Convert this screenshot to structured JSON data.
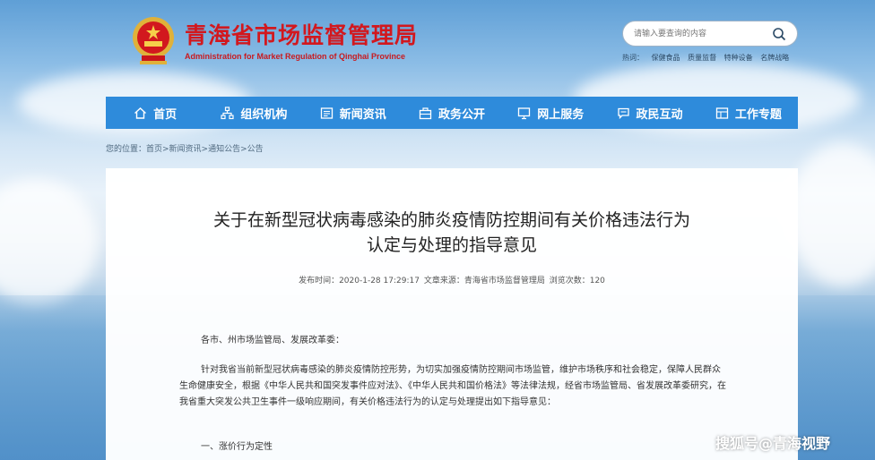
{
  "header": {
    "title": "青海省市场监督管理局",
    "subtitle": "Administration for Market Regulation of Qinghai Province",
    "emblem_icon": "national-emblem-icon"
  },
  "search": {
    "placeholder": "请输入要查询的内容",
    "hot_label": "热词：",
    "hot_words": [
      "保健食品",
      "质量监督",
      "特种设备",
      "名牌战略"
    ]
  },
  "nav": {
    "items": [
      {
        "label": "首页",
        "icon": "home-icon"
      },
      {
        "label": "组织机构",
        "icon": "org-chart-icon"
      },
      {
        "label": "新闻资讯",
        "icon": "news-icon"
      },
      {
        "label": "政务公开",
        "icon": "briefcase-icon"
      },
      {
        "label": "网上服务",
        "icon": "monitor-icon"
      },
      {
        "label": "政民互动",
        "icon": "chat-icon"
      },
      {
        "label": "工作专题",
        "icon": "topic-icon"
      }
    ]
  },
  "breadcrumb": "您的位置：首页>新闻资讯>通知公告>公告",
  "article": {
    "title_line1": "关于在新型冠状病毒感染的肺炎疫情防控期间有关价格违法行为",
    "title_line2": "认定与处理的指导意见",
    "publish_time": "发布时间：2020-1-28 17:29:17",
    "source": "文章来源：青海省市场监督管理局",
    "views": "浏览次数：120",
    "salutation": "各市、州市场监管局、发展改革委：",
    "paragraph": "针对我省当前新型冠状病毒感染的肺炎疫情防控形势，为切实加强疫情防控期间市场监管，维护市场秩序和社会稳定，保障人民群众生命健康安全，根据《中华人民共和国突发事件应对法》、《中华人民共和国价格法》等法律法规，经省市场监管局、省发展改革委研究，在我省重大突发公共卫生事件一级响应期间，有关价格违法行为的认定与处理提出如下指导意见：",
    "section_heading": "一、涨价行为定性"
  },
  "watermark": "搜狐号@青海视野",
  "colors": {
    "nav_bg": "#2e8bdb",
    "title_red": "#d2181e"
  }
}
